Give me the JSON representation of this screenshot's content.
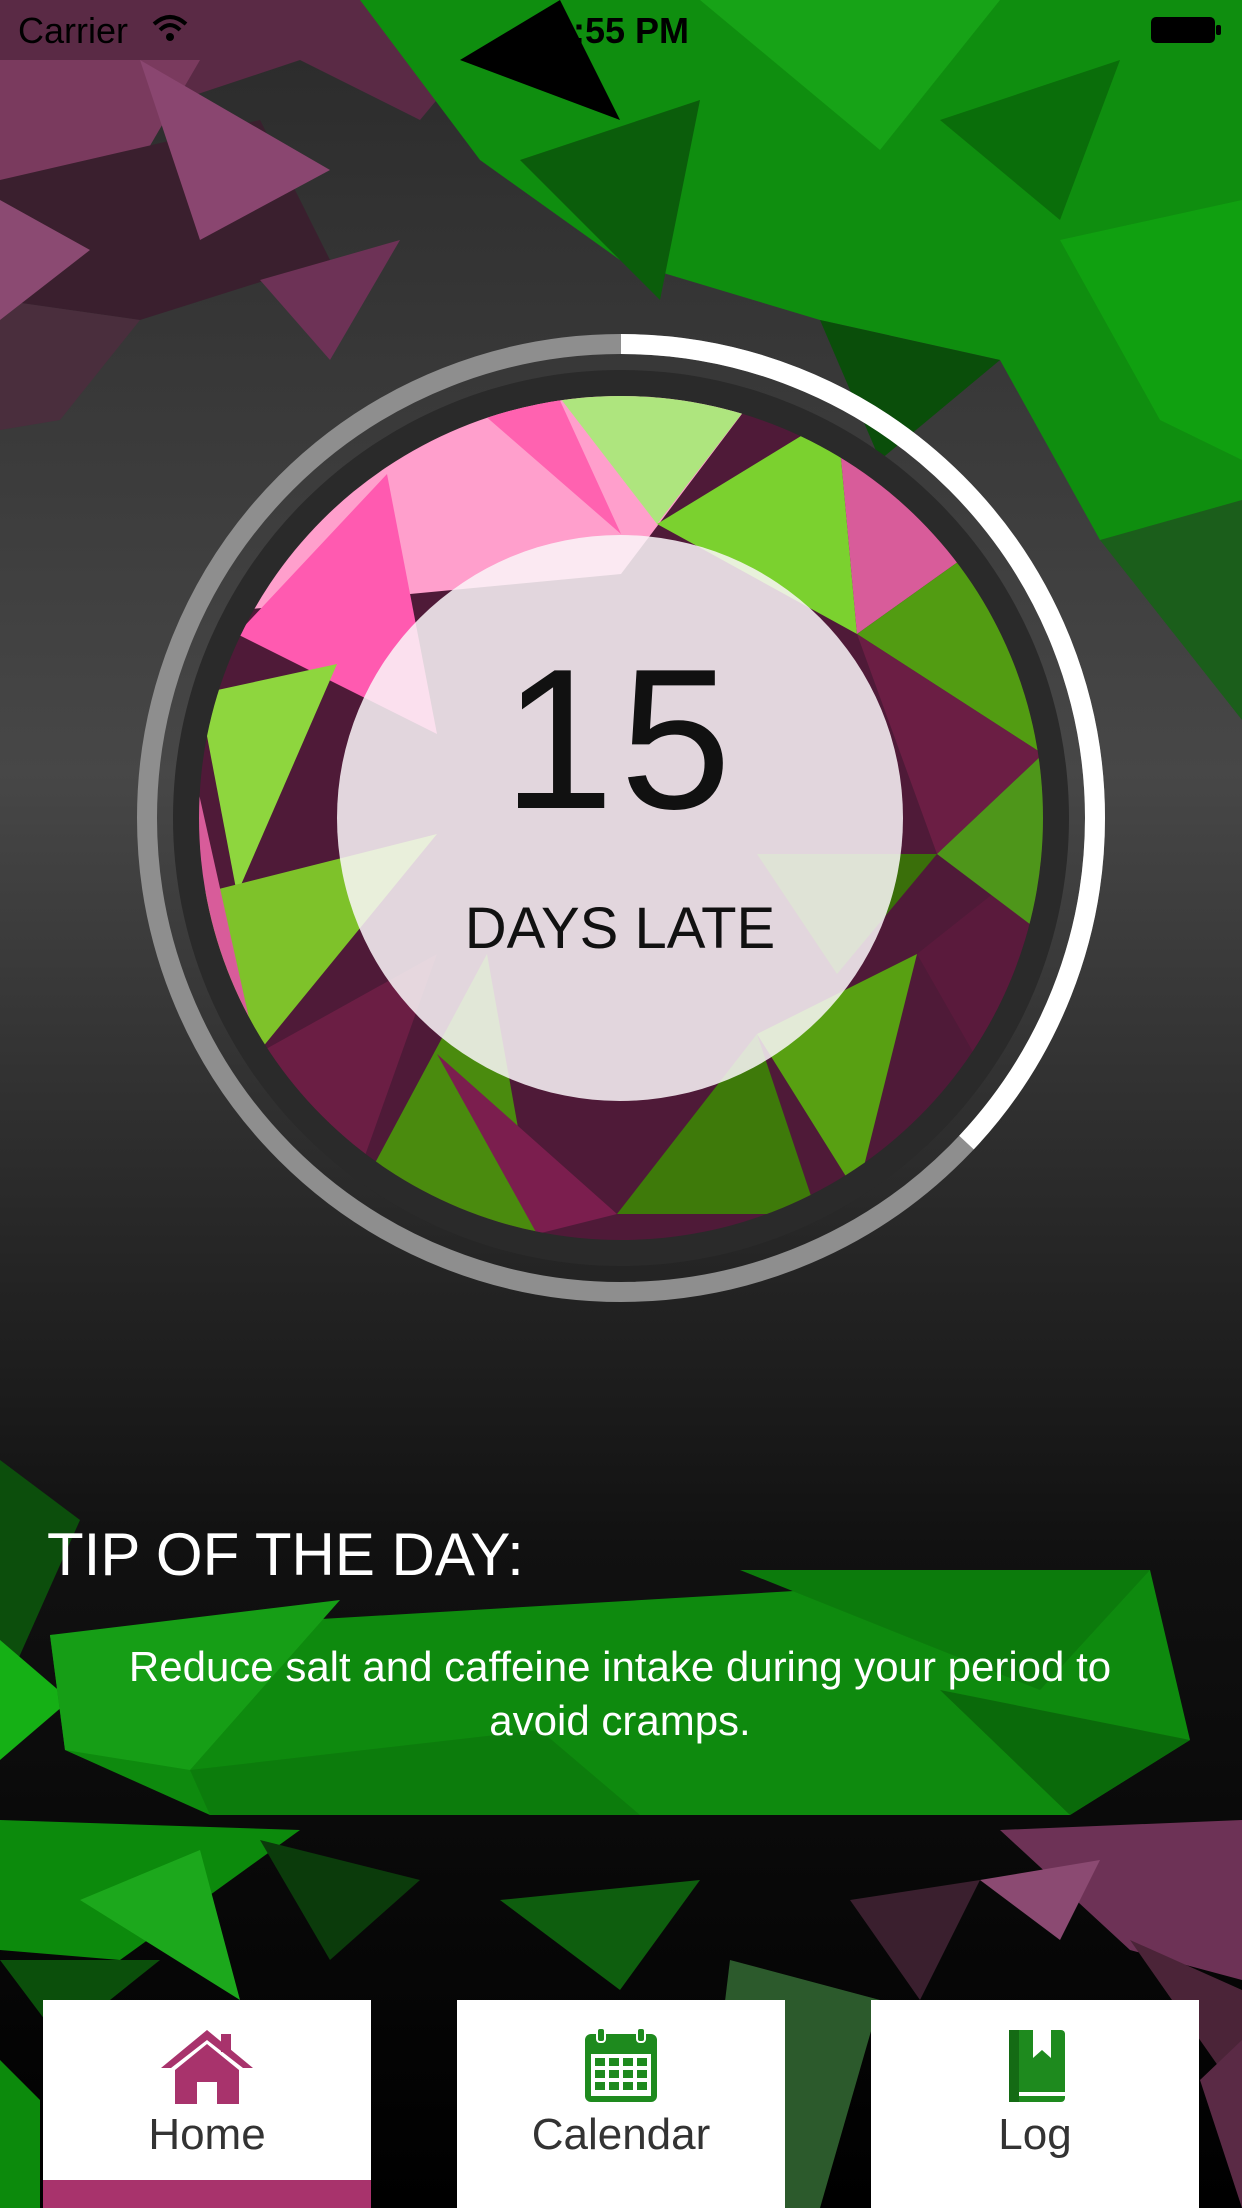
{
  "status_bar": {
    "carrier": "Carrier",
    "time": "1:55 PM"
  },
  "counter": {
    "value": "15",
    "label": "DAYS LATE",
    "progress": 0.37
  },
  "tip": {
    "title": "TIP OF THE DAY:",
    "text": "Reduce salt and caffeine intake during your period to avoid cramps."
  },
  "tabs": [
    {
      "label": "Home",
      "icon": "home-icon",
      "active": true
    },
    {
      "label": "Calendar",
      "icon": "calendar-icon",
      "active": false
    },
    {
      "label": "Log",
      "icon": "book-icon",
      "active": false
    }
  ],
  "colors": {
    "pink": "#a8336c",
    "green": "#1e9b1e",
    "dark_bg": "#1e1e1e"
  }
}
